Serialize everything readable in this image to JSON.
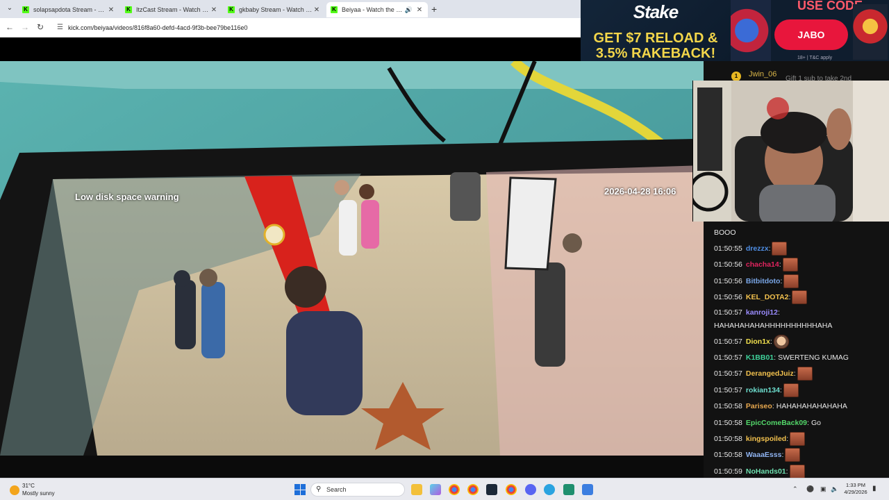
{
  "browser": {
    "tabs": [
      {
        "title": "solapsapdota Stream - Watch Live on Kick",
        "active": false
      },
      {
        "title": "ItzCast Stream - Watch Live on Kick",
        "active": false
      },
      {
        "title": "gkbaby Stream - Watch Live on Kick",
        "active": false
      },
      {
        "title": "Beiyaa - Watch the VOD on Kick",
        "active": true
      }
    ],
    "url": "kick.com/beiyaa/videos/816f8a60-defd-4acd-9f3b-bee79be116e0"
  },
  "video": {
    "overlay_warning": "Low disk space warning",
    "overlay_timestamp": "2026-04-28 16:06"
  },
  "ad": {
    "brand": "Stake",
    "line1": "GET $7 RELOAD &",
    "line2": "3.5% RAKEBACK!",
    "code_label": "USE CODE",
    "code": "JABO",
    "tc": "18+ | T&C apply"
  },
  "chat": {
    "pinned_rank": "1",
    "pinned_user": "Jwin_06",
    "pinned_text": "Gift 1 sub to take 2nd",
    "messages": [
      {
        "ts": "",
        "user": "",
        "color": "#e9e9e9",
        "text": "BOOO",
        "emote": false
      },
      {
        "ts": "01:50:55",
        "user": "drezzx",
        "color": "#4f8fe6",
        "text": "",
        "emote": true
      },
      {
        "ts": "01:50:56",
        "user": "chacha14",
        "color": "#e0245e",
        "text": "",
        "emote": true
      },
      {
        "ts": "01:50:56",
        "user": "Bitbitdoto",
        "color": "#7aa7e8",
        "text": "",
        "emote": true
      },
      {
        "ts": "01:50:56",
        "user": "KEL_DOTA2",
        "color": "#f2c14e",
        "text": "",
        "emote": true
      },
      {
        "ts": "01:50:57",
        "user": "kanroji12",
        "color": "#9b8cff",
        "text": "HAHAHAHAHAHHHHHHHHHHAHA",
        "emote": false,
        "wrap": true
      },
      {
        "ts": "01:50:57",
        "user": "Dion1x",
        "color": "#f2e14e",
        "text": "",
        "emote": true,
        "face": true
      },
      {
        "ts": "01:50:57",
        "user": "K1BB01",
        "color": "#3fd19a",
        "text": "SWERTENG KUMAG",
        "emote": false
      },
      {
        "ts": "01:50:57",
        "user": "DerangedJuiz",
        "color": "#f2c14e",
        "text": "",
        "emote": true
      },
      {
        "ts": "01:50:57",
        "user": "rokian134",
        "color": "#6ee0d0",
        "text": "",
        "emote": true
      },
      {
        "ts": "01:50:58",
        "user": "Pariseo",
        "color": "#e8a84e",
        "text": "HAHAHAHAHAHAHA",
        "emote": false
      },
      {
        "ts": "01:50:58",
        "user": "EpicComeBack09",
        "color": "#53d86a",
        "text": "Go",
        "emote": false
      },
      {
        "ts": "01:50:58",
        "user": "kingspoiled",
        "color": "#f2c14e",
        "text": "",
        "emote": true
      },
      {
        "ts": "01:50:58",
        "user": "WaaaEsss",
        "color": "#8fb3f0",
        "text": "",
        "emote": true
      },
      {
        "ts": "01:50:59",
        "user": "NoHands01",
        "color": "#6ee0b0",
        "text": "",
        "emote": true
      }
    ]
  },
  "taskbar": {
    "temp": "31°C",
    "weather": "Mostly sunny",
    "search_placeholder": "Search",
    "time": "1:33 PM",
    "date": "4/29/2026"
  },
  "icons": {
    "tab_menu": "chevron-down-icon",
    "close": "close-icon",
    "back": "back-icon",
    "forward": "forward-icon",
    "reload": "reload-icon",
    "site_info": "tune-icon",
    "audio": "speaker-icon",
    "start": "windows-icon",
    "search": "search-icon"
  },
  "colors": {
    "kick_green": "#53fc18",
    "chat_bg": "#121212",
    "stake_red": "#e8163c",
    "stake_yellow": "#f3d64a"
  }
}
